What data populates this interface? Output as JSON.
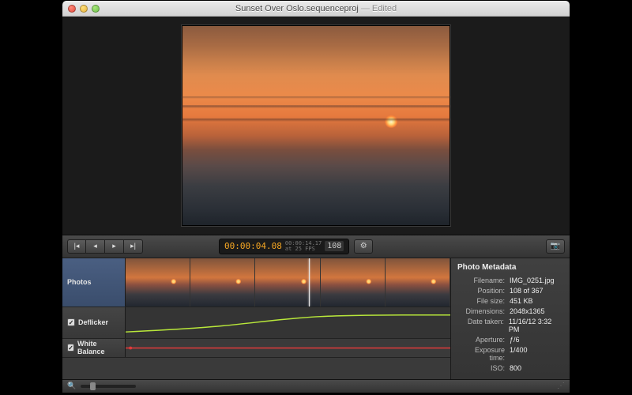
{
  "window": {
    "title": "Sunset Over Oslo.sequenceproj",
    "edited": "— Edited"
  },
  "toolbar": {
    "timecode": "00:00:04.08",
    "total": "00:00:14.17",
    "fps_label": "at 25 FPS",
    "frame": "108"
  },
  "tracks": {
    "photos_label": "Photos",
    "deflicker_label": "Deflicker",
    "deflicker_checked": "✓",
    "wb_label": "White Balance",
    "wb_checked": "✓"
  },
  "metadata": {
    "title": "Photo Metadata",
    "rows": [
      {
        "k": "Filename:",
        "v": "IMG_0251.jpg"
      },
      {
        "k": "Position:",
        "v": "108 of 367"
      },
      {
        "k": "File size:",
        "v": "451 KB"
      },
      {
        "k": "Dimensions:",
        "v": "2048x1365"
      },
      {
        "k": "Date taken:",
        "v": "11/16/12 3:32 PM"
      },
      {
        "k": "Aperture:",
        "v": "ƒ/6"
      },
      {
        "k": "Exposure time:",
        "v": "1/400"
      },
      {
        "k": "ISO:",
        "v": "800"
      }
    ]
  }
}
